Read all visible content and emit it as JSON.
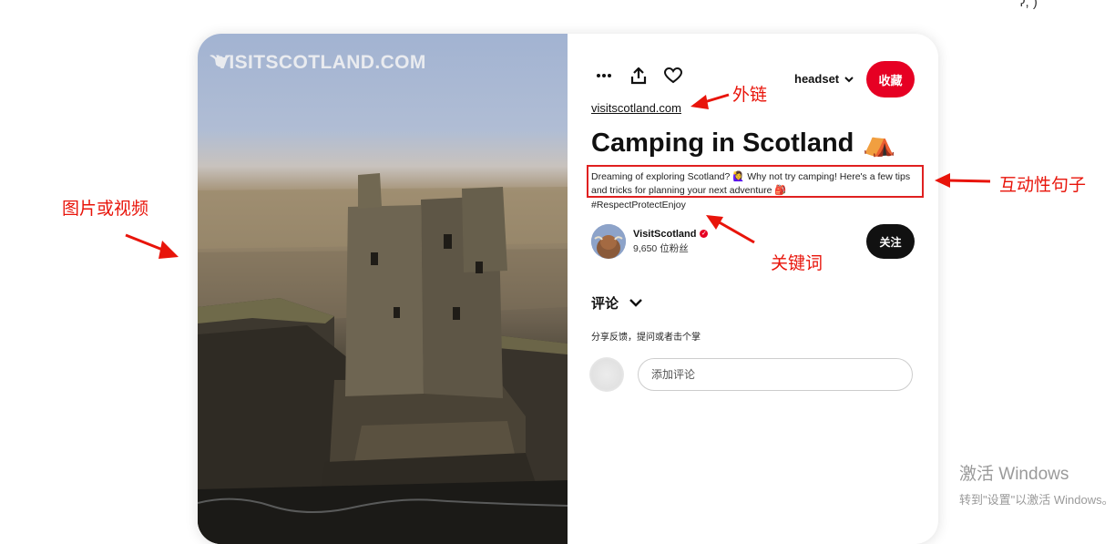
{
  "media": {
    "watermark_text": "VISITSCOTLAND.COM",
    "watermark_logo": "highland-cow-icon",
    "kind": "castle-ruin-video"
  },
  "toolbar": {
    "more_icon": "more-dots-icon",
    "share_icon": "share-upload-icon",
    "like_icon": "heart-icon"
  },
  "board_select": {
    "label": "headset",
    "icon": "chevron-down-icon"
  },
  "save_button": {
    "label": "收藏",
    "color": "#e60023"
  },
  "pin": {
    "source_link": "visitscotland.com",
    "title": "Camping in Scotland",
    "title_emoji": "⛺",
    "description": "Dreaming of exploring Scotland? 🙋‍♀️ Why not try camping! Here's a few tips and tricks for planning your next adventure 🎒",
    "hashtag": "#RespectProtectEnjoy"
  },
  "creator": {
    "name": "VisitScotland",
    "verified_icon": "verified-badge-icon",
    "followers": "9,650 位粉丝",
    "follow_label": "关注"
  },
  "comments": {
    "header": "评论",
    "hint": "分享反馈，提问或者击个掌",
    "input_placeholder": "添加评论"
  },
  "annotations": {
    "media_label": "图片或视频",
    "link_label": "外链",
    "description_label": "互动性句子",
    "keyword_label": "关键词",
    "color": "#e8140a"
  },
  "os_watermark": {
    "title": "激活 Windows",
    "subtitle": "转到\"设置\"以激活 Windows。"
  },
  "corner_text": "ʔ, )"
}
